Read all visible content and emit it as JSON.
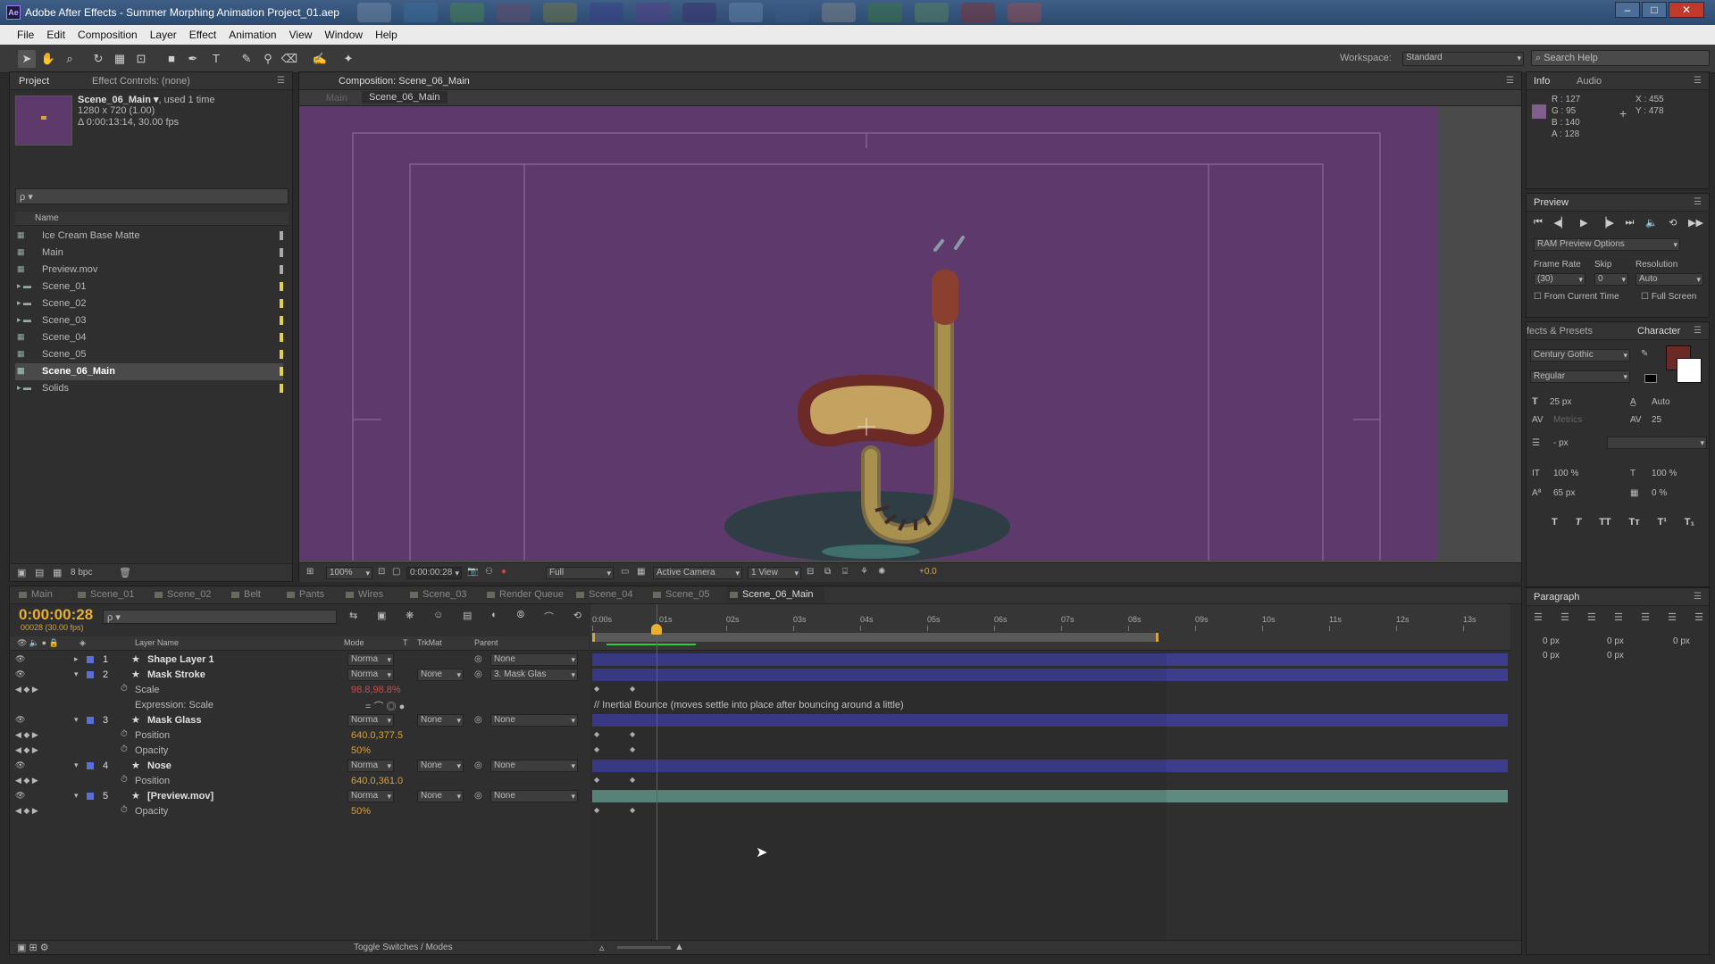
{
  "window": {
    "title": "Adobe After Effects - Summer Morphing Animation Project_01.aep",
    "app_icon": "Ae"
  },
  "menu": [
    "File",
    "Edit",
    "Composition",
    "Layer",
    "Effect",
    "Animation",
    "View",
    "Window",
    "Help"
  ],
  "workspace": {
    "label": "Workspace:",
    "value": "Standard",
    "search_placeholder": "Search Help"
  },
  "project": {
    "tab": "Project",
    "tab2": "Effect Controls: (none)",
    "selected_name": "Scene_06_Main ▾",
    "used": ", used 1 time",
    "size": "1280 x 720 (1.00)",
    "duration": "Δ 0:00:13:14, 30.00 fps",
    "search_placeholder": "ρ ▾",
    "name_header": "Name",
    "items": [
      {
        "name": "Ice Cream Base Matte",
        "type": "comp"
      },
      {
        "name": "Main",
        "type": "comp"
      },
      {
        "name": "Preview.mov",
        "type": "footage"
      },
      {
        "name": "Scene_01",
        "type": "folder"
      },
      {
        "name": "Scene_02",
        "type": "folder"
      },
      {
        "name": "Scene_03",
        "type": "folder"
      },
      {
        "name": "Scene_04",
        "type": "comp"
      },
      {
        "name": "Scene_05",
        "type": "comp"
      },
      {
        "name": "Scene_06_Main",
        "type": "comp",
        "selected": true
      },
      {
        "name": "Solids",
        "type": "folder"
      }
    ],
    "bpc": "8 bpc"
  },
  "composition": {
    "tab": "Composition: Scene_06_Main",
    "crumb_main": "Main",
    "crumb_current": "Scene_06_Main",
    "zoom": "100%",
    "timecode": "0:00:00:28",
    "resolution": "Full",
    "camera": "Active Camera",
    "views": "1 View",
    "exposure": "+0.0",
    "bg_color": "#5e3a6c"
  },
  "info": {
    "tab": "Info",
    "tab2": "Audio",
    "r": "R : 127",
    "g": "G : 95",
    "b": "B : 140",
    "a": "A : 128",
    "x": "X : 455",
    "y": "Y : 478",
    "swatch": "#7f5f8c"
  },
  "preview": {
    "tab": "Preview",
    "ram": "RAM Preview Options",
    "frame_rate_label": "Frame Rate",
    "skip_label": "Skip",
    "resolution_label": "Resolution",
    "frame_rate": "(30)",
    "skip": "0",
    "resolution": "Auto",
    "from_current": "From Current Time",
    "full_screen": "Full Screen"
  },
  "character": {
    "tab1": "fects & Presets",
    "tab": "Character",
    "font": "Century Gothic",
    "style": "Regular",
    "size": "25 px",
    "leading": "Auto",
    "kerning": "Metrics",
    "tracking": "25",
    "stroke": "- px",
    "vscale": "100 %",
    "hscale": "100 %",
    "baseline": "65 px",
    "tsume": "0 %",
    "styles": [
      "T",
      "T",
      "TT",
      "Tт",
      "T¹",
      "T₁"
    ]
  },
  "paragraph": {
    "tab": "Paragraph",
    "vals": [
      "0 px",
      "0 px",
      "0 px",
      "0 px",
      "0 px"
    ]
  },
  "timeline": {
    "tabs": [
      "Main",
      "Scene_01",
      "Scene_02",
      "Belt",
      "Pants",
      "Wires",
      "Scene_03",
      "Render Queue",
      "Scene_04",
      "Scene_05",
      "Scene_06_Main"
    ],
    "timecode": "0:00:00:28",
    "frames": "00028 (30.00 fps)",
    "search_placeholder": "ρ ▾",
    "headers": {
      "name": "Layer Name",
      "mode": "Mode",
      "t": "T",
      "trkmat": "TrkMat",
      "parent": "Parent"
    },
    "ruler": [
      "0:00s",
      "01s",
      "02s",
      "03s",
      "04s",
      "05s",
      "06s",
      "07s",
      "08s",
      "09s",
      "10s",
      "11s",
      "12s",
      "13s"
    ],
    "rows": [
      {
        "kind": "layer",
        "num": "1",
        "name": "Shape Layer 1",
        "mode": "Norma",
        "trk": "",
        "parent": "None",
        "color": "#3d3d8c"
      },
      {
        "kind": "layer",
        "num": "2",
        "name": "Mask Stroke",
        "mode": "Norma",
        "trk": "None",
        "parent": "3. Mask Glas",
        "color": "#3d3d8c"
      },
      {
        "kind": "prop",
        "name": "Scale",
        "value": "98.8,98.8%",
        "red": true
      },
      {
        "kind": "expr",
        "name": "Expression: Scale",
        "text": "// Inertial Bounce (moves settle into place after bouncing around a little)"
      },
      {
        "kind": "layer",
        "num": "3",
        "name": "Mask Glass",
        "mode": "Norma",
        "trk": "None",
        "parent": "None",
        "color": "#3d3d8c"
      },
      {
        "kind": "prop",
        "name": "Position",
        "value": "640.0,377.5"
      },
      {
        "kind": "prop",
        "name": "Opacity",
        "value": "50%"
      },
      {
        "kind": "layer",
        "num": "4",
        "name": "Nose",
        "mode": "Norma",
        "trk": "None",
        "parent": "None",
        "color": "#3d3d8c"
      },
      {
        "kind": "prop",
        "name": "Position",
        "value": "640.0,361.0"
      },
      {
        "kind": "layer",
        "num": "5",
        "name": "[Preview.mov]",
        "mode": "Norma",
        "trk": "None",
        "parent": "None",
        "color": "#5e8a80"
      },
      {
        "kind": "prop",
        "name": "Opacity",
        "value": "50%"
      }
    ],
    "toggle": "Toggle Switches / Modes"
  }
}
